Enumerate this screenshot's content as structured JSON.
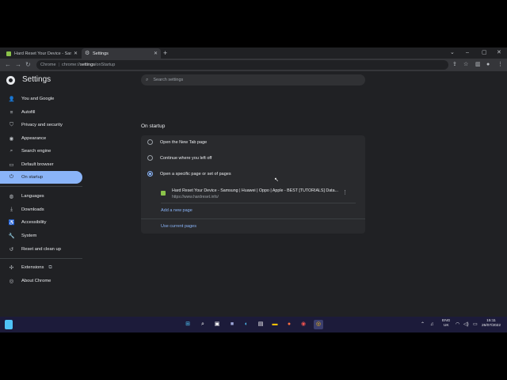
{
  "tabs": [
    {
      "title": "Hard Reset Your Device - Samsu...",
      "active": false
    },
    {
      "title": "Settings",
      "active": true
    }
  ],
  "address_bar": {
    "origin_chip": "Chrome",
    "url_prefix": "chrome://",
    "url_bold": "settings",
    "url_suffix": "/onStartup"
  },
  "header": {
    "title": "Settings",
    "search_placeholder": "Search settings"
  },
  "sidebar": {
    "items": [
      {
        "label": "You and Google",
        "icon": "person-icon"
      },
      {
        "label": "Autofill",
        "icon": "autofill-icon"
      },
      {
        "label": "Privacy and security",
        "icon": "shield-icon"
      },
      {
        "label": "Appearance",
        "icon": "palette-icon"
      },
      {
        "label": "Search engine",
        "icon": "search-icon"
      },
      {
        "label": "Default browser",
        "icon": "browser-icon"
      },
      {
        "label": "On startup",
        "icon": "power-icon",
        "active": true
      },
      {
        "label": "Languages",
        "icon": "globe-icon"
      },
      {
        "label": "Downloads",
        "icon": "download-icon"
      },
      {
        "label": "Accessibility",
        "icon": "accessibility-icon"
      },
      {
        "label": "System",
        "icon": "wrench-icon"
      },
      {
        "label": "Reset and clean up",
        "icon": "reset-icon"
      },
      {
        "label": "Extensions",
        "icon": "puzzle-icon"
      },
      {
        "label": "About Chrome",
        "icon": "chrome-icon"
      }
    ]
  },
  "on_startup": {
    "title": "On startup",
    "options": [
      {
        "label": "Open the New Tab page",
        "selected": false
      },
      {
        "label": "Continue where you left off",
        "selected": false
      },
      {
        "label": "Open a specific page or set of pages",
        "selected": true
      }
    ],
    "page": {
      "title": "Hard Reset Your Device - Samsung | Huawei | Oppo | Apple - BEST [TUTORIALS] Data...",
      "url": "https://www.hardreset.info/"
    },
    "add_new_page": "Add a new page",
    "use_current_pages": "Use current pages"
  },
  "taskbar": {
    "lang_top": "ENG",
    "lang_bottom": "UK",
    "time": "15:11",
    "date": "26/07/2022"
  },
  "colors": {
    "accent": "#8ab4f8",
    "background": "#202124",
    "card": "#292a2d"
  }
}
